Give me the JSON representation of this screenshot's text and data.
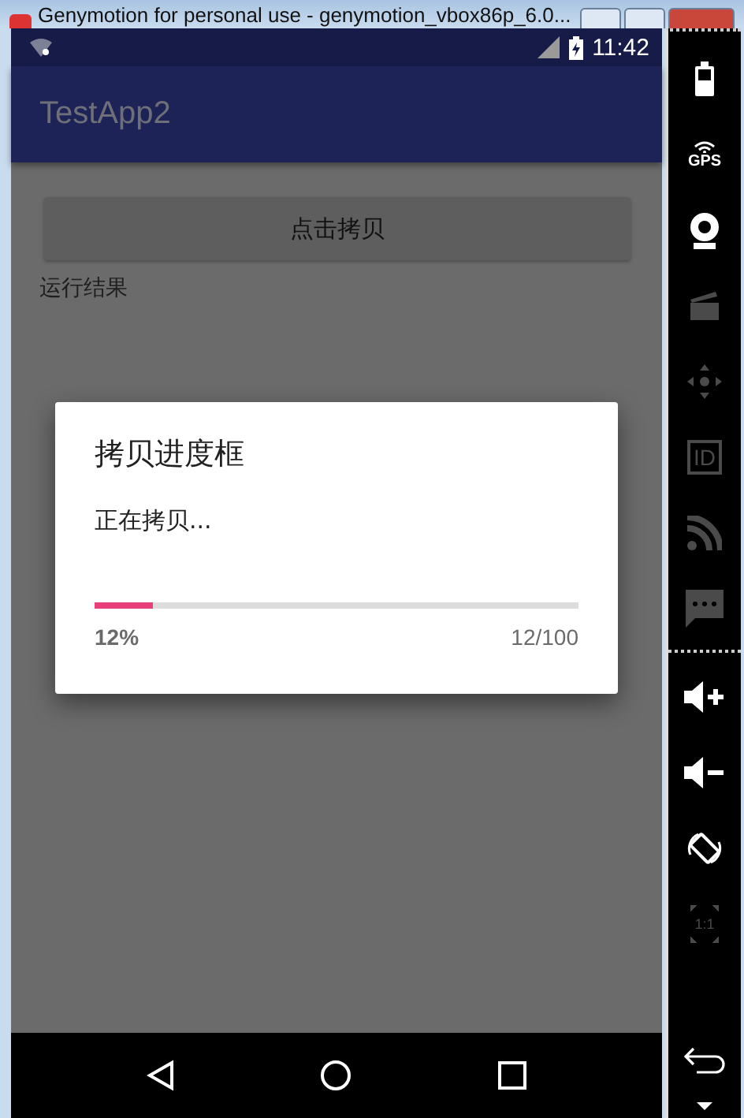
{
  "window": {
    "title": "Genymotion for personal use - genymotion_vbox86p_6.0..."
  },
  "status_bar": {
    "time": "11:42"
  },
  "app_bar": {
    "title": "TestApp2"
  },
  "content": {
    "button": "点击拷贝",
    "result_label": "运行结果"
  },
  "dialog": {
    "title": "拷贝进度框",
    "message": "正在拷贝...",
    "level": 0.12,
    "percent": "12%",
    "count": "12/100"
  },
  "sidebar": {
    "top": [
      {
        "kind": "battery",
        "disabled": false
      },
      {
        "kind": "gps",
        "label": "GPS",
        "disabled": false
      },
      {
        "kind": "camera",
        "disabled": false
      },
      {
        "kind": "clapper",
        "disabled": true
      },
      {
        "kind": "move",
        "disabled": true
      },
      {
        "kind": "id",
        "label": "ID",
        "disabled": true
      },
      {
        "kind": "rss",
        "disabled": true
      },
      {
        "kind": "sms",
        "disabled": true
      }
    ],
    "bottom": [
      {
        "kind": "volup",
        "disabled": false
      },
      {
        "kind": "voldown",
        "disabled": false
      },
      {
        "kind": "rotate",
        "disabled": false
      },
      {
        "kind": "scale",
        "label": "1:1",
        "disabled": true
      }
    ],
    "footer": [
      {
        "kind": "back",
        "disabled": false
      },
      {
        "kind": "caret",
        "disabled": false
      }
    ]
  }
}
